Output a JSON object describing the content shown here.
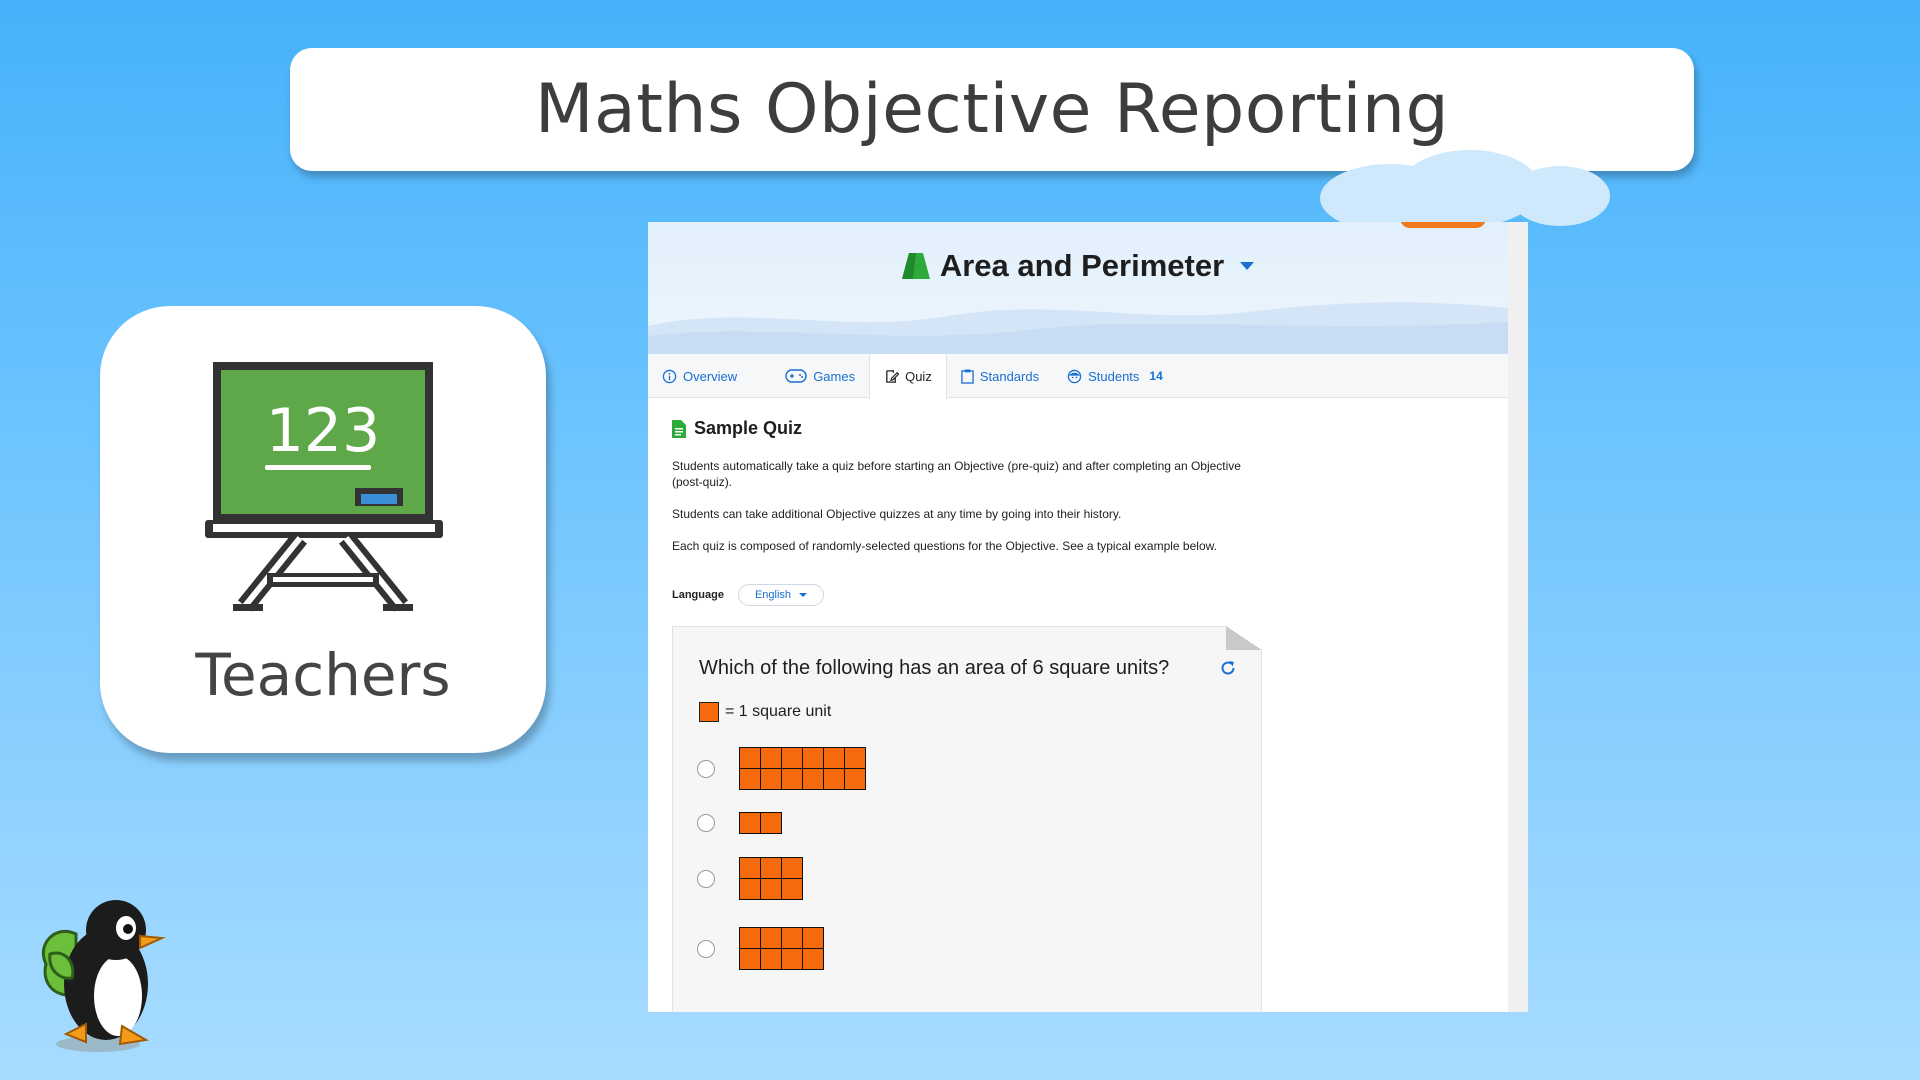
{
  "banner": {
    "title": "Maths Objective Reporting"
  },
  "teacher_card": {
    "board_text": "123",
    "label": "Teachers"
  },
  "panel": {
    "header_title": "Area and Perimeter",
    "tabs": [
      {
        "label": "Overview",
        "icon": "info-icon",
        "active": false
      },
      {
        "label": "Games",
        "icon": "gamepad-icon",
        "active": false
      },
      {
        "label": "Quiz",
        "icon": "edit-icon",
        "active": true
      },
      {
        "label": "Standards",
        "icon": "clipboard-icon",
        "active": false
      },
      {
        "label": "Students",
        "icon": "student-icon",
        "active": false,
        "count": "14"
      }
    ],
    "quiz": {
      "title": "Sample Quiz",
      "desc1": "Students automatically take a quiz before starting an Objective (pre-quiz) and after completing an Objective (post-quiz).",
      "desc2": "Students can take additional Objective quizzes at any time by going into their history.",
      "desc3": "Each quiz is composed of randomly-selected questions for the Objective. See a typical example below.",
      "language_label": "Language",
      "language_value": "English",
      "question": "Which of the following has an area of 6 square units?",
      "legend": "= 1 square unit"
    }
  },
  "colors": {
    "accent": "#1a6fd0",
    "orange": "#f46a0c",
    "board_green": "#5fa84a"
  }
}
